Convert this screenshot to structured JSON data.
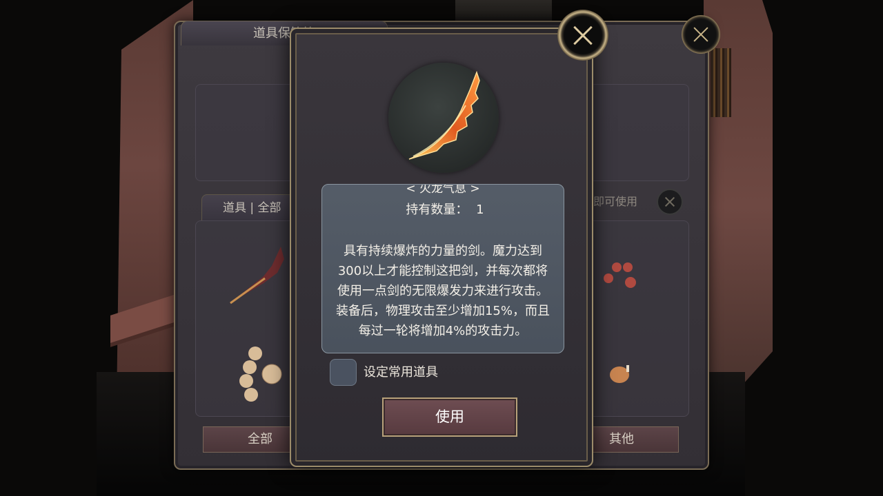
{
  "back_panel": {
    "title": "道具保管箱",
    "filter_tab": "道具 | 全部",
    "hint": "击道具即可使用",
    "bottom_tabs": [
      "全部",
      "其他"
    ]
  },
  "dialog": {
    "item_name": "< 火龙气息 >",
    "quantity_label": "持有数量：",
    "quantity_value": "1",
    "description": "具有持续爆炸的力量的剑。魔力达到300以上才能控制这把剑，并每次都将使用一点剑的无限爆发力来进行攻击。装备后，物理攻击至少增加15%，而且每过一轮将增加4%的攻击力。",
    "favorite_label": "设定常用道具",
    "use_button": "使用"
  }
}
